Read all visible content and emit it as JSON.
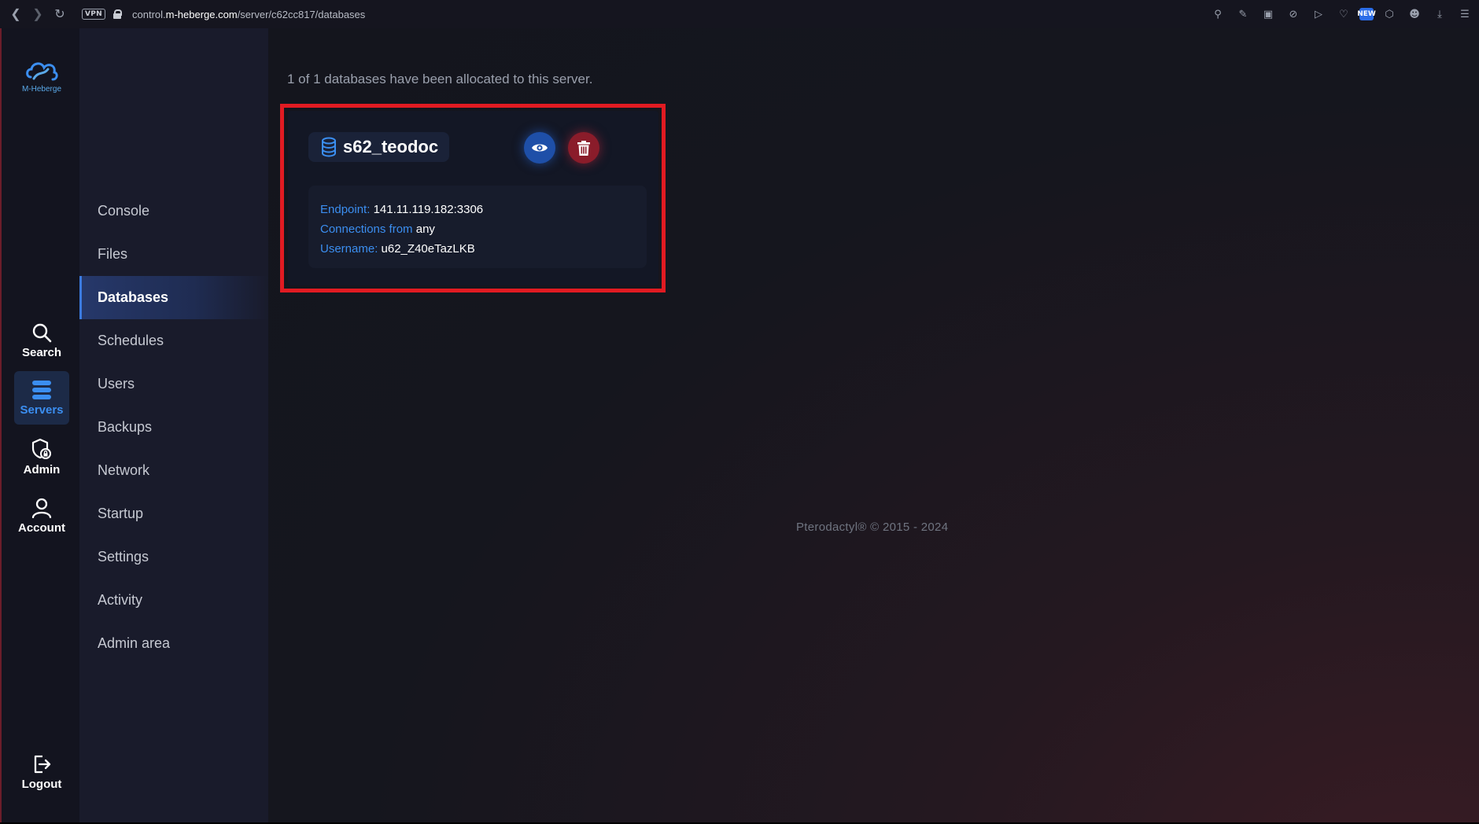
{
  "browser": {
    "vpn_label": "VPN",
    "url_prefix": "control.",
    "url_domain": "m-heberge.com",
    "url_path": "/server/c62cc817/databases",
    "ext_label": "NEW"
  },
  "rail": {
    "logo_text": "M-Heberge",
    "items": [
      {
        "label": "Search",
        "icon": "search-icon"
      },
      {
        "label": "Servers",
        "icon": "servers-icon"
      },
      {
        "label": "Admin",
        "icon": "admin-icon"
      },
      {
        "label": "Account",
        "icon": "account-icon"
      }
    ],
    "logout_label": "Logout"
  },
  "subnav": {
    "items": [
      "Console",
      "Files",
      "Databases",
      "Schedules",
      "Users",
      "Backups",
      "Network",
      "Startup",
      "Settings",
      "Activity",
      "Admin area"
    ],
    "active": "Databases"
  },
  "main": {
    "allocation_text": "1 of 1 databases have been allocated to this server.",
    "database": {
      "name": "s62_teodoc",
      "endpoint_label": "Endpoint:",
      "endpoint_value": "141.11.119.182:3306",
      "connections_label": "Connections from",
      "connections_value": "any",
      "username_label": "Username:",
      "username_value": "u62_Z40eTazLKB"
    },
    "footer": "Pterodactyl® © 2015 - 2024"
  },
  "colors": {
    "accent": "#3b8ef0",
    "highlight": "#e11b22",
    "danger": "#8a1c2a"
  }
}
